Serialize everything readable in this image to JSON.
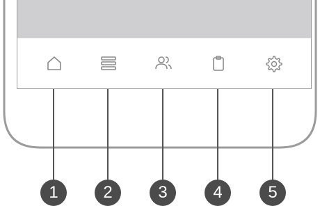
{
  "callouts": [
    {
      "number": "1",
      "icon": "home-icon"
    },
    {
      "number": "2",
      "icon": "menu-list-icon"
    },
    {
      "number": "3",
      "icon": "users-icon"
    },
    {
      "number": "4",
      "icon": "clipboard-icon"
    },
    {
      "number": "5",
      "icon": "gear-icon"
    }
  ],
  "colors": {
    "phone_outline": "#9b9b9b",
    "header_fill": "#cfcfd1",
    "icon_stroke": "#8a8a8a",
    "leader_line": "#555555",
    "callout_fill": "#4b4b4b",
    "callout_text": "#ffffff"
  }
}
